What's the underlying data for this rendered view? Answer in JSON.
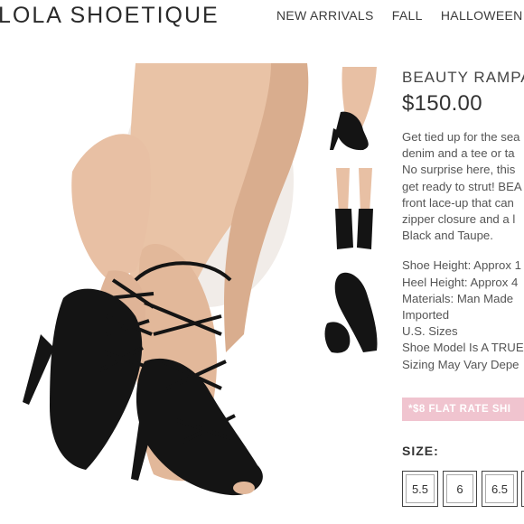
{
  "header": {
    "logo": "LOLA SHOETIQUE",
    "nav": [
      "NEW ARRIVALS",
      "FALL",
      "HALLOWEEN"
    ]
  },
  "product": {
    "title": "BEAUTY RAMPAGE",
    "price": "$150.00",
    "description": [
      "Get tied up for the sea",
      "denim and a tee or ta",
      "No surprise here, this",
      "get ready to strut! BEA",
      "front lace-up that can",
      "zipper closure and a l",
      "Black and Taupe."
    ],
    "specs": [
      "Shoe Height: Approx 1",
      "Heel Height: Approx 4",
      "Materials: Man Made",
      "Imported",
      "U.S. Sizes",
      "Shoe Model Is A TRUE",
      "Sizing May Vary Depe"
    ]
  },
  "promo": "*$8 FLAT RATE SHI",
  "size": {
    "label": "SIZE:",
    "options": [
      "5.5",
      "6",
      "6.5"
    ]
  },
  "colors": {
    "promo_bg": "#f0c4cf",
    "skin": "#e8c0a4",
    "shoe": "#141414"
  }
}
